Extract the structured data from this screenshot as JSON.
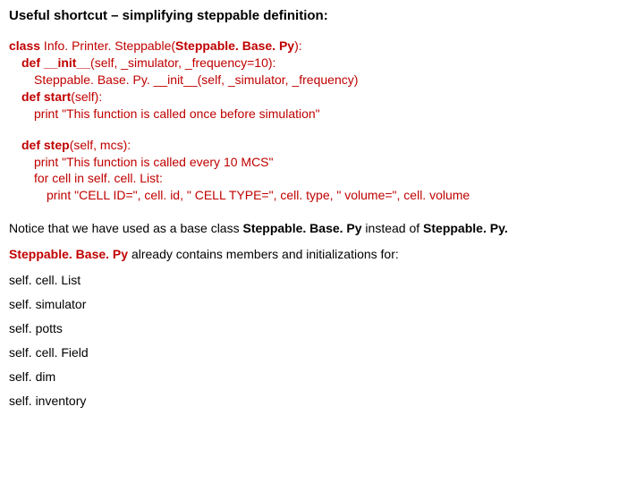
{
  "heading": "Useful shortcut – simplifying steppable definition:",
  "code": {
    "l1_kw": "class",
    "l1_rest": " Info. Printer. Steppable(",
    "l1_bold": "Steppable. Base. Py",
    "l1_tail": "):",
    "l2_kw": "def __init__",
    "l2_rest": "(self, _simulator, _frequency=10):",
    "l3": "Steppable. Base. Py. __init__(self, _simulator, _frequency)",
    "l4_kw": "def start",
    "l4_rest": "(self):",
    "l5": "print \"This function is called once before simulation\"",
    "l6_kw": "def step",
    "l6_rest": "(self, mcs):",
    "l7": "print \"This function is called every 10 MCS\"",
    "l8": "for cell in self. cell. List:",
    "l9": "print \"CELL ID=\", cell. id, \" CELL TYPE=\", cell. type, \" volume=\", cell. volume"
  },
  "para1_a": "Notice that we have used as a base class ",
  "para1_b": "Steppable. Base. Py",
  "para1_c": " instead of ",
  "para1_d": "Steppable. Py.",
  "para2_a": "Steppable. Base. Py",
  "para2_b": " already contains members and initializations for:",
  "members": {
    "m1": "self. cell. List",
    "m2": "self. simulator",
    "m3": "self. potts",
    "m4": "self. cell. Field",
    "m5": "self. dim",
    "m6": "self. inventory"
  }
}
